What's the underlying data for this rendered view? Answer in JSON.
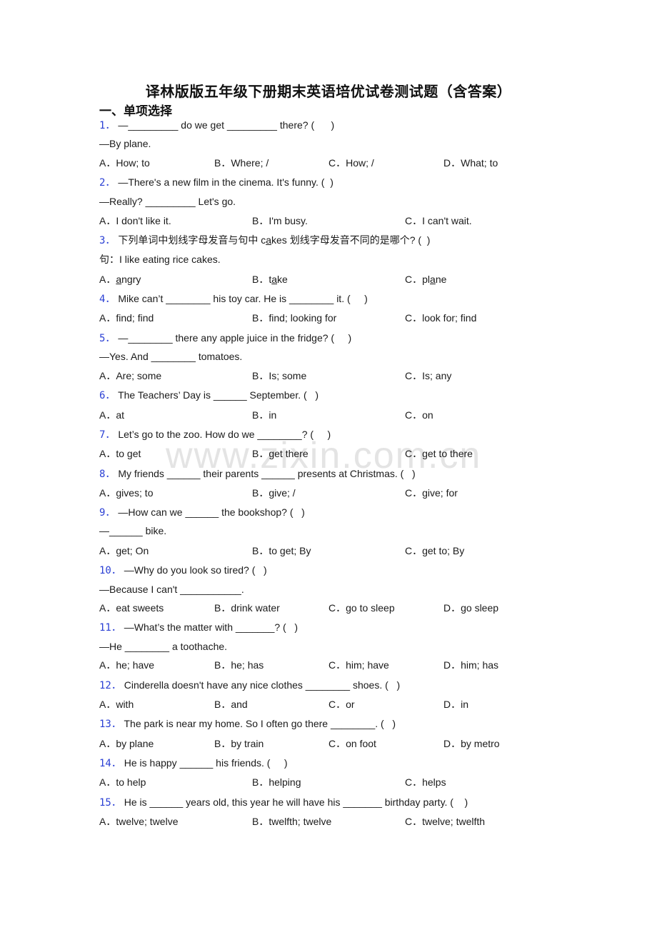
{
  "title": "译林版版五年级下册期末英语培优试卷测试题（含答案）",
  "section": "一、单项选择",
  "watermark": "www.zixin.com.cn",
  "colors": {
    "question_number": "#2a3fd4",
    "watermark": "#e4e4e4",
    "text": "#1a1a1a"
  },
  "questions": [
    {
      "num": "1．",
      "stem": "—_________ do we get _________ there? (      )",
      "lines": [
        "—By plane."
      ],
      "options": [
        "A．How; to",
        "B．Where; /",
        "C．How; /",
        "D．What; to"
      ]
    },
    {
      "num": "2．",
      "stem": "—There's a new film in the cinema. It's funny. (  )",
      "lines": [
        "—Really? _________ Let's go."
      ],
      "options": [
        "A．I don't like it.",
        "B．I'm busy.",
        "C．I can't wait."
      ]
    },
    {
      "num": "3．",
      "stem_pre": "下列单词中划线字母发音与句中 c",
      "stem_u": "a",
      "stem_post": "kes 划线字母发音不同的是哪个? (  )",
      "lines": [
        "句：I like eating rice cakes."
      ],
      "options_u": [
        {
          "label": "A．",
          "pre": "",
          "u": "a",
          "post": "ngry"
        },
        {
          "label": "B．",
          "pre": "t",
          "u": "a",
          "post": "ke"
        },
        {
          "label": "C．",
          "pre": "pl",
          "u": "a",
          "post": "ne"
        }
      ]
    },
    {
      "num": "4．",
      "stem": "Mike can’t ________ his toy car. He is ________ it. (     )",
      "lines": [],
      "options": [
        "A．find; find",
        "B．find; looking for",
        "C．look for; find"
      ]
    },
    {
      "num": "5．",
      "stem": "—________ there any apple juice in the fridge? (     )",
      "lines": [
        "—Yes. And ________ tomatoes."
      ],
      "options": [
        "A．Are; some",
        "B．Is; some",
        "C．Is; any"
      ]
    },
    {
      "num": "6．",
      "stem": "The Teachers’ Day is ______ September. (   )",
      "lines": [],
      "options": [
        "A．at",
        "B．in",
        "C．on"
      ]
    },
    {
      "num": "7．",
      "stem": "Let’s go to the zoo. How do we ________? (     )",
      "lines": [],
      "options": [
        "A．to get",
        "B．get there",
        "C．get to there"
      ]
    },
    {
      "num": "8．",
      "stem": "My friends ______ their parents ______ presents at Christmas. (   )",
      "lines": [],
      "options": [
        "A．gives; to",
        "B．give; /",
        "C．give; for"
      ]
    },
    {
      "num": "9．",
      "stem": "—How can we ______ the bookshop? (   )",
      "lines": [
        "—______ bike."
      ],
      "options": [
        "A．get; On",
        "B．to get; By",
        "C．get to; By"
      ]
    },
    {
      "num": "10．",
      "stem": "—Why do you look so tired? (   )",
      "lines": [
        "—Because I can't ___________."
      ],
      "options": [
        "A．eat sweets",
        "B．drink water",
        "C．go to sleep",
        "D．go sleep"
      ]
    },
    {
      "num": "11．",
      "stem": "—What’s the matter with _______? (   )",
      "lines": [
        "—He ________ a toothache."
      ],
      "options": [
        "A．he; have",
        "B．he; has",
        "C．him; have",
        "D．him; has"
      ]
    },
    {
      "num": "12．",
      "stem": "Cinderella doesn't have any nice clothes ________ shoes. (   )",
      "lines": [],
      "options": [
        "A．with",
        "B．and",
        "C．or",
        "D．in"
      ]
    },
    {
      "num": "13．",
      "stem": "The park is near my home. So I often go there ________. (   )",
      "lines": [],
      "options": [
        "A．by plane",
        "B．by train",
        "C．on foot",
        "D．by metro"
      ]
    },
    {
      "num": "14．",
      "stem": "He is happy ______ his friends. (     )",
      "lines": [],
      "options": [
        "A．to help",
        "B．helping",
        "C．helps"
      ]
    },
    {
      "num": "15．",
      "stem": "He is ______ years old, this year he will have his _______ birthday party. (    )",
      "lines": [],
      "options": [
        "A．twelve; twelve",
        "B．twelfth; twelve",
        "C．twelve; twelfth"
      ]
    }
  ]
}
